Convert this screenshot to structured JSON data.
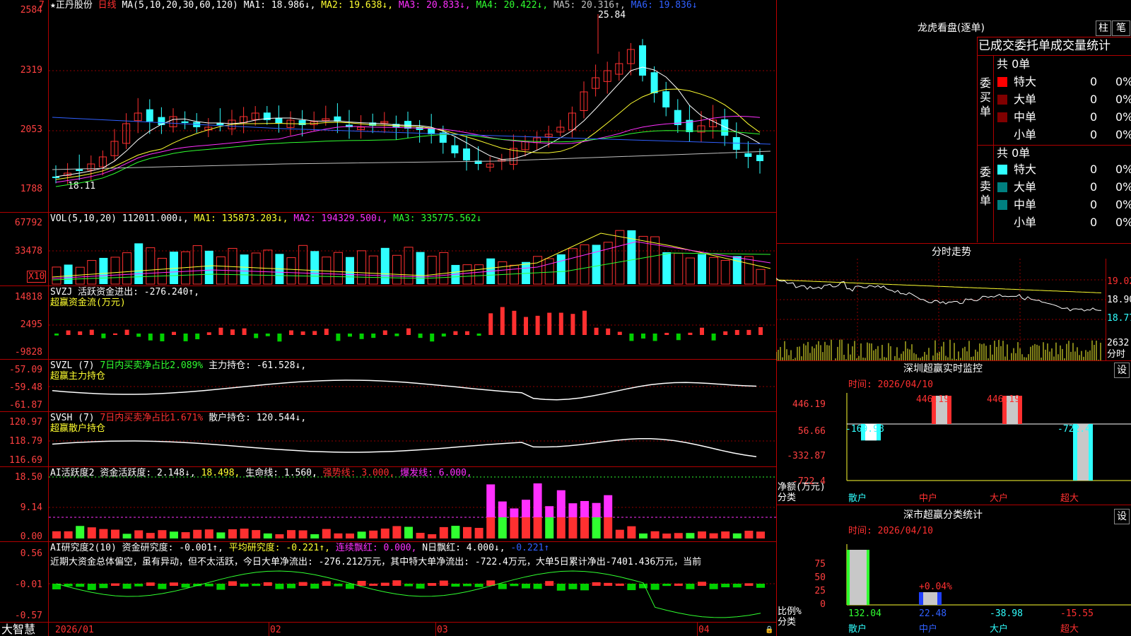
{
  "colors": {
    "up": "#ff3030",
    "down": "#30ffff",
    "ma1": "#ffffff",
    "ma2": "#ffff30",
    "ma3": "#ff30ff",
    "ma4": "#30ff30",
    "ma5": "#c0c0c0",
    "ma6": "#3060ff",
    "grid": "#b00000"
  },
  "main": {
    "title_star": "★",
    "stock": "正丹股份",
    "period": "日线",
    "ma_label": "MA(5,10,20,30,60,120)",
    "ma1": "MA1: 18.986↓,",
    "ma2": "MA2: 19.638↓,",
    "ma3": "MA3: 20.833↓,",
    "ma4": "MA4: 20.422↓,",
    "ma5": "MA5: 20.316↑,",
    "ma6": "MA6: 19.836↓",
    "high_label": "25.84",
    "low_label": "18.11",
    "axis": [
      "2584",
      "2319",
      "2053",
      "1788"
    ],
    "corner": "7"
  },
  "vol": {
    "title": "VOL(5,10,20)",
    "v": "112011.000↓,",
    "ma1": "MA1: 135873.203↓,",
    "ma2": "MA2: 194329.500↓,",
    "ma3": "MA3: 335775.562↓",
    "axis": [
      "67792",
      "33478"
    ],
    "unit": "X10"
  },
  "svzj": {
    "title": "SVZJ",
    "label": "活跃资金进出: -276.240↑,",
    "sub": "超赢资金流(万元)",
    "axis": [
      "14818",
      "2495",
      "-9828"
    ]
  },
  "svzl": {
    "title": "SVZL (7)",
    "t2": "7日内买卖净占比2.089%",
    "t3": "主力持仓: -61.528↓,",
    "sub": "超赢主力持仓",
    "axis": [
      "-57.09",
      "-59.48",
      "-61.87"
    ]
  },
  "svsh": {
    "title": "SVSH (7)",
    "t2": "7日内买卖净占比1.671%",
    "t3": "散户持仓: 120.544↓,",
    "sub": "超赢散户持仓",
    "axis": [
      "120.97",
      "118.79",
      "116.69"
    ]
  },
  "ai1": {
    "title": "AI活跃度2",
    "t2": "资金活跃度: 2.148↓,",
    "t3": "18.498,",
    "t4": "生命线: 1.560,",
    "t5": "强势线: 3.000,",
    "t6": "爆发线: 6.000,",
    "axis": [
      "18.50",
      "9.14",
      "0.00"
    ]
  },
  "ai2": {
    "title": "AI研究度2(10)",
    "t2": "资金研究度: -0.001↑,",
    "t3": "平均研究度: -0.221↑,",
    "t4": "连续飘红: 0.000,",
    "t5": "N日飘红: 4.000↓,",
    "t6": "-0.221↑",
    "summary": "近期大资金总体偏空，虽有异动，但不太活跃，今日大单净流出: -276.212万元，其中特大单净流出: -722.4万元，大单5日累计净出-7401.436万元，当前",
    "axis": [
      "0.56",
      "-0.01",
      "-0.57"
    ]
  },
  "dates": [
    "2026/01",
    "02",
    "03",
    "04"
  ],
  "logo": "大智慧",
  "right": {
    "dragon_title": "龙虎看盘(逐单)",
    "btn1": "柱",
    "btn2": "笔",
    "tabs": "已成交委托单成交量统计",
    "buy": {
      "side": "委买单",
      "total": "共 0单",
      "rows": [
        {
          "name": "特大",
          "n": "0",
          "p": "0%",
          "color": "#ff0000"
        },
        {
          "name": "大单",
          "n": "0",
          "p": "0%",
          "color": "#800000"
        },
        {
          "name": "中单",
          "n": "0",
          "p": "0%",
          "color": "#800000"
        },
        {
          "name": "小单",
          "n": "0",
          "p": "0%",
          "color": "#000000"
        }
      ]
    },
    "sell": {
      "side": "委卖单",
      "total": "共 0单",
      "rows": [
        {
          "name": "特大",
          "n": "0",
          "p": "0%",
          "color": "#30ffff"
        },
        {
          "name": "大单",
          "n": "0",
          "p": "0%",
          "color": "#008080"
        },
        {
          "name": "中单",
          "n": "0",
          "p": "0%",
          "color": "#008080"
        },
        {
          "name": "小单",
          "n": "0",
          "p": "0%",
          "color": "#000000"
        }
      ]
    },
    "fenshi": {
      "title": "分时走势",
      "p1": "19.02",
      "p2": "18.90",
      "p3": "18.77",
      "v": "2632",
      "unit": "分时"
    },
    "sz1": {
      "title": "深圳超赢实时监控",
      "btn": "设",
      "time": "时间: 2026/04/10",
      "axis": [
        "446.19",
        "56.66",
        "-332.87",
        "-722.4"
      ],
      "ylabel": "净额(万元)",
      "xlabel": "分类",
      "cats": [
        "散户",
        "中户",
        "大户",
        "超大"
      ],
      "values": [
        -169.98,
        446.19,
        446.19,
        -722.4
      ],
      "labels": [
        "-169.98",
        "446.19",
        "446.19",
        "-722.4"
      ]
    },
    "sz2": {
      "title": "深市超赢分类统计",
      "btn": "设",
      "time": "时间: 2026/04/10",
      "axis": [
        "75",
        "50",
        "25",
        "0"
      ],
      "ylabel": "比例%",
      "xlabel": "分类",
      "cats": [
        "散户",
        "中户",
        "大户",
        "超大"
      ],
      "vals": [
        "132.04",
        "22.48",
        "-38.98",
        "-15.55"
      ],
      "mid_label": "+0.04%"
    }
  }
}
